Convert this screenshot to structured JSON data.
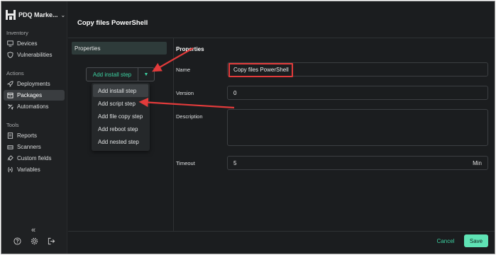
{
  "app": {
    "name": "PDQ Marke...",
    "caret": "⌄"
  },
  "sidebar": {
    "sections": [
      {
        "label": "Inventory"
      },
      {
        "label": "Actions"
      },
      {
        "label": "Tools"
      }
    ],
    "items": [
      {
        "label": "Devices",
        "icon": "monitor-icon"
      },
      {
        "label": "Vulnerabilities",
        "icon": "shield-icon"
      },
      {
        "label": "Deployments",
        "icon": "rocket-icon"
      },
      {
        "label": "Packages",
        "icon": "package-icon",
        "active": true
      },
      {
        "label": "Automations",
        "icon": "automation-icon"
      },
      {
        "label": "Reports",
        "icon": "reports-icon"
      },
      {
        "label": "Scanners",
        "icon": "scanner-icon"
      },
      {
        "label": "Custom fields",
        "icon": "custom-fields-icon"
      },
      {
        "label": "Variables",
        "icon": "variables-icon"
      }
    ],
    "collapse_glyph": "«"
  },
  "page": {
    "title": "Copy files PowerShell"
  },
  "left_panel": {
    "tab_label": "Properties",
    "add_install_label": "Add install step",
    "dropdown_items": [
      {
        "label": "Add install step"
      },
      {
        "label": "Add script step"
      },
      {
        "label": "Add file copy step"
      },
      {
        "label": "Add reboot step"
      },
      {
        "label": "Add nested step"
      }
    ]
  },
  "properties": {
    "heading": "Properties",
    "name_label": "Name",
    "name_value": "Copy files PowerShell",
    "version_label": "Version",
    "version_value": "0",
    "description_label": "Description",
    "description_value": "",
    "timeout_label": "Timeout",
    "timeout_value": "5",
    "timeout_unit": "Min"
  },
  "footer": {
    "cancel_label": "Cancel",
    "save_label": "Save"
  },
  "colors": {
    "accent": "#3dd2a2",
    "save_bg": "#5fe3b5",
    "annotation": "#e23b3b",
    "background": "#1b1d1f"
  }
}
